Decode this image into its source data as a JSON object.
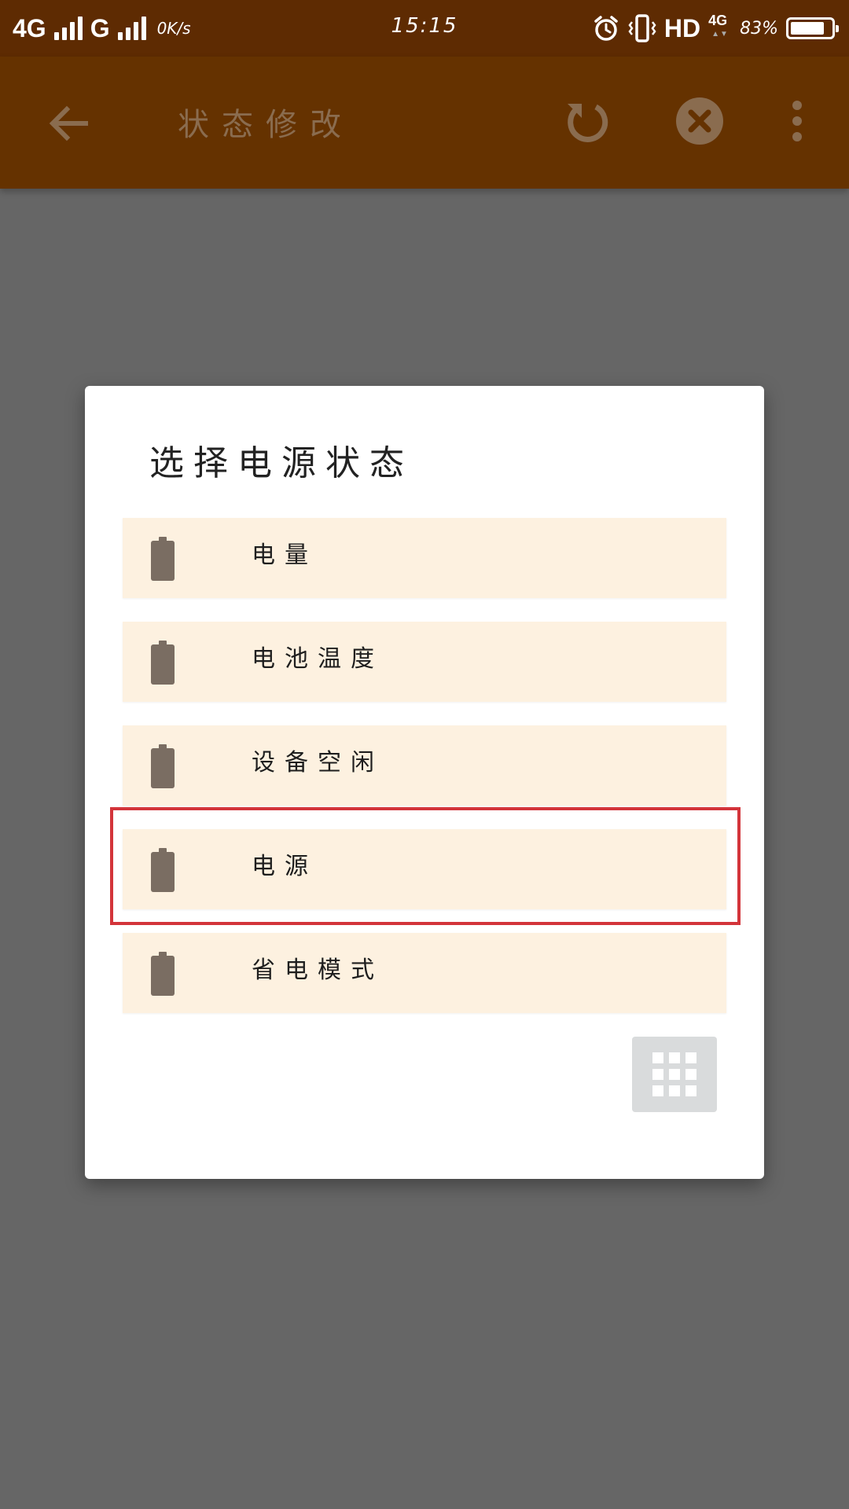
{
  "status_bar": {
    "network_1": "4G",
    "network_2": "G",
    "speed": "0K/s",
    "time": "15:15",
    "hd": "HD",
    "mini_network": "4G",
    "battery_percent": "83%",
    "battery_level": 0.83
  },
  "app_bar": {
    "title": "状态修改",
    "icons": {
      "back": "arrow-left-icon",
      "reset": "refresh-icon",
      "close": "close-circle-icon",
      "more": "more-vertical-icon"
    }
  },
  "dialog": {
    "title": "选择电源状态",
    "options": [
      {
        "label": "电量",
        "icon": "battery-icon"
      },
      {
        "label": "电池温度",
        "icon": "battery-icon"
      },
      {
        "label": "设备空闲",
        "icon": "battery-icon"
      },
      {
        "label": "电源",
        "icon": "battery-icon",
        "highlighted": true
      },
      {
        "label": "省电模式",
        "icon": "battery-icon"
      }
    ],
    "grid_button_icon": "grid-icon"
  },
  "colors": {
    "status_bar": "#5e2b02",
    "app_bar": "#653200",
    "overlay": "#666666",
    "option_bg": "#fdf1e0",
    "option_icon": "#7a6d62",
    "highlight": "#d3343a"
  }
}
